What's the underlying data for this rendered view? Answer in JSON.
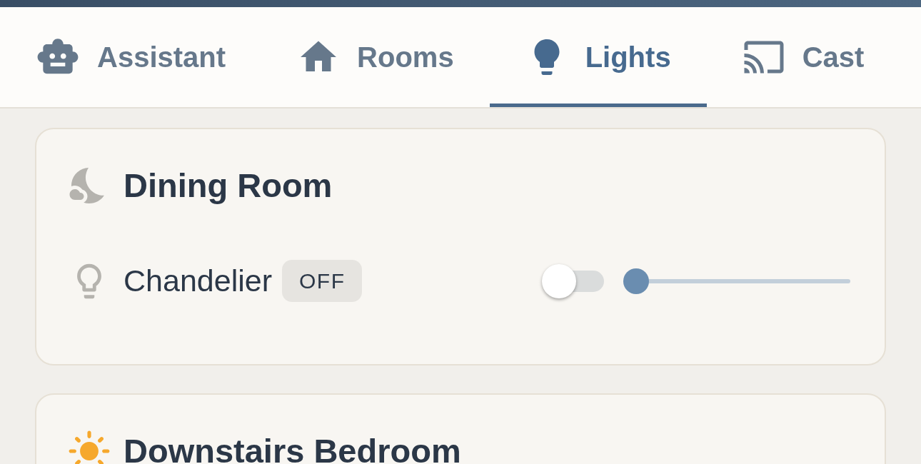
{
  "tabs": [
    {
      "label": "Assistant",
      "selected": false
    },
    {
      "label": "Rooms",
      "selected": false
    },
    {
      "label": "Lights",
      "selected": true
    },
    {
      "label": "Cast",
      "selected": false
    }
  ],
  "rooms": [
    {
      "name": "Dining Room",
      "kind": "night",
      "lights": [
        {
          "name": "Chandelier",
          "on": false,
          "status": "OFF",
          "level": 0
        }
      ]
    },
    {
      "name": "Downstairs Bedroom",
      "kind": "day"
    }
  ]
}
